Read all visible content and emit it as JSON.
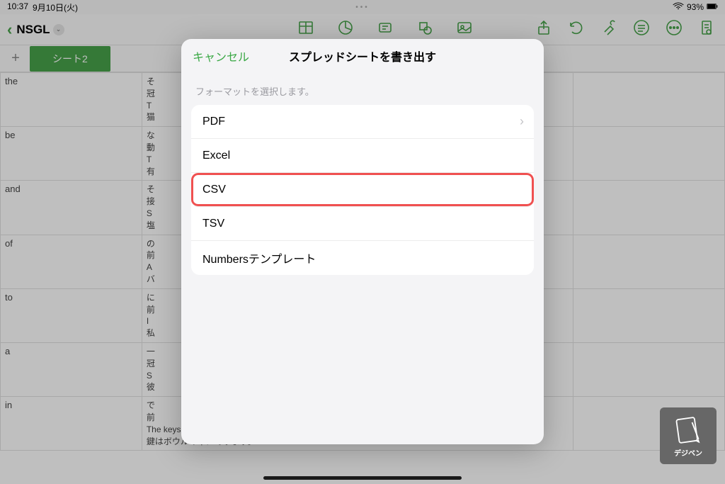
{
  "status": {
    "time": "10:37",
    "date": "9月10日(火)",
    "battery": "93%"
  },
  "doc": {
    "title": "NSGL"
  },
  "sheet": {
    "add": "+",
    "name": "シート2"
  },
  "cellsA": [
    "the",
    "be",
    "and",
    "of",
    "to",
    "a",
    "in"
  ],
  "cellsB": [
    "そ\n冠\nT\n猫",
    "な\n動\nT\n有",
    "そ\n接\nS\n塩",
    "の\n前\nA\nバ",
    "に\n前\nI\n私",
    "一\n冠\nS\n彼",
    "で\n前\nThe keys are in the bowl.\n鍵はボウルの中にあります。"
  ],
  "modal": {
    "cancel": "キャンセル",
    "title": "スプレッドシートを書き出す",
    "subtitle": "フォーマットを選択します。",
    "options": [
      "PDF",
      "Excel",
      "CSV",
      "TSV",
      "Numbersテンプレート"
    ]
  },
  "watermark": "デジベン"
}
